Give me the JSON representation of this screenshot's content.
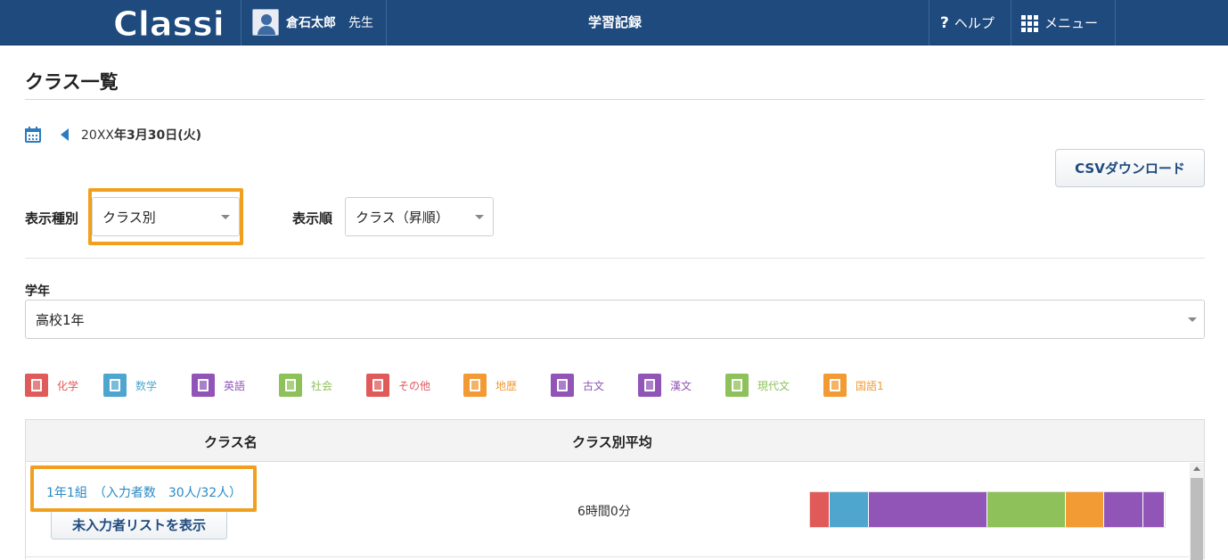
{
  "header": {
    "logo_text": "Classi",
    "user_name": "倉石太郎",
    "user_suffix": "先生",
    "app_title": "学習記録",
    "help_label": "ヘルプ",
    "menu_label": "メニュー"
  },
  "page": {
    "title": "クラス一覧",
    "date_prefix": "20XX",
    "date_main": "年3月30日(火)",
    "csv_button": "CSVダウンロード"
  },
  "filters": {
    "display_type_label": "表示種別",
    "display_type_value": "クラス別",
    "display_order_label": "表示順",
    "display_order_value": "クラス（昇順）",
    "grade_label": "学年",
    "grade_value": "高校1年"
  },
  "legend": [
    {
      "label": "化学",
      "color": "#e05a5a",
      "icon": "book-icon"
    },
    {
      "label": "数学",
      "color": "#4ea6cf",
      "icon": "book-icon"
    },
    {
      "label": "英語",
      "color": "#9155b8",
      "icon": "book-icon"
    },
    {
      "label": "社会",
      "color": "#8fc15a",
      "icon": "edit-icon"
    },
    {
      "label": "その他",
      "color": "#e05a5a",
      "icon": "edit-icon"
    },
    {
      "label": "地歴",
      "color": "#f29a33",
      "icon": "edit-icon"
    },
    {
      "label": "古文",
      "color": "#9155b8",
      "icon": "open-book-icon"
    },
    {
      "label": "漢文",
      "color": "#9155b8",
      "icon": "edit-icon"
    },
    {
      "label": "現代文",
      "color": "#8fc15a",
      "icon": "book-icon"
    },
    {
      "label": "国語1",
      "color": "#f29a33",
      "icon": "book-icon"
    }
  ],
  "table": {
    "col_class": "クラス名",
    "col_avg": "クラス別平均",
    "rows": [
      {
        "class_link": "1年1組　（入力者数　30人/32人）",
        "missing_button": "未入力者リストを表示",
        "average": "6時間0分",
        "breakdown": [
          {
            "subject": "化学",
            "color": "#e05a5a",
            "share": 0.055
          },
          {
            "subject": "数学",
            "color": "#4ea6cf",
            "share": 0.11
          },
          {
            "subject": "英語",
            "color": "#9155b8",
            "share": 0.335
          },
          {
            "subject": "現代文",
            "color": "#8fc15a",
            "share": 0.22
          },
          {
            "subject": "国語1",
            "color": "#f29a33",
            "share": 0.11
          },
          {
            "subject": "古文",
            "color": "#9155b8",
            "share": 0.11
          },
          {
            "subject": "漢文",
            "color": "#9155b8",
            "share": 0.06
          }
        ]
      }
    ]
  }
}
